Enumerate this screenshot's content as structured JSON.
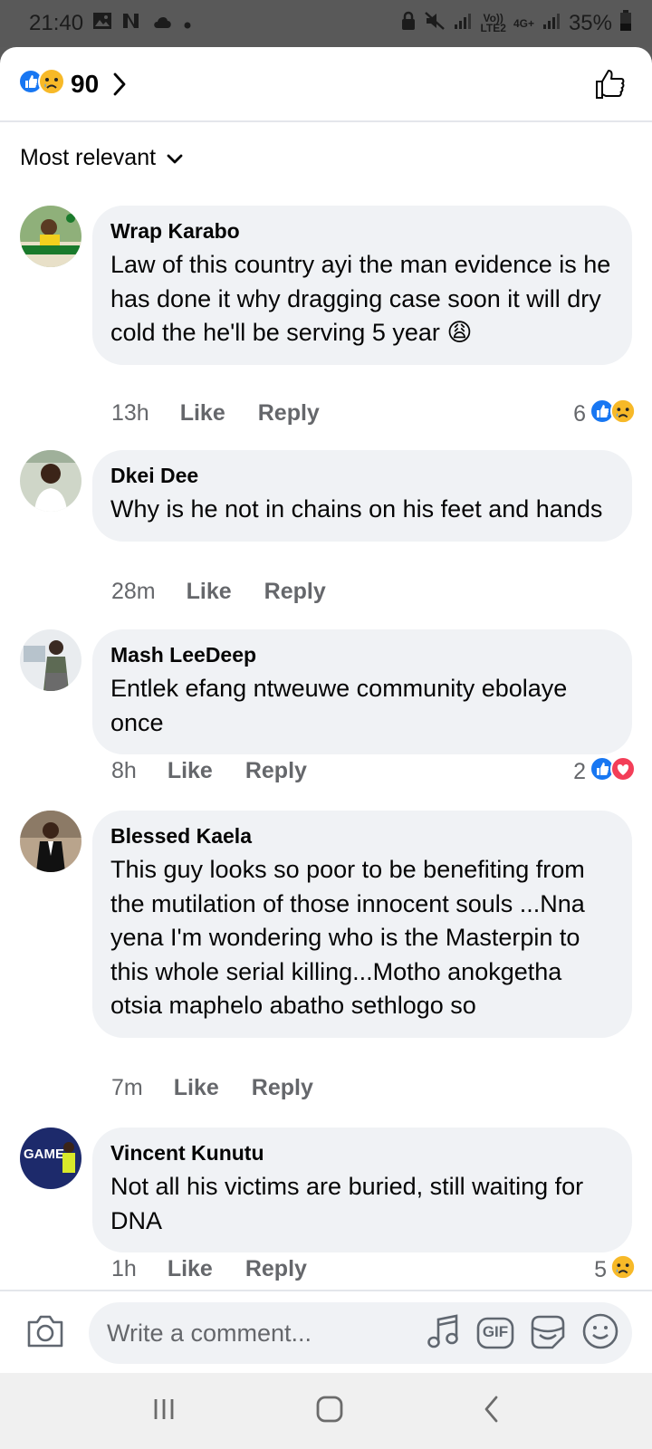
{
  "status_bar": {
    "time": "21:40",
    "signal_label_top": "Vo))",
    "signal_label_bottom": "LTE2",
    "network": "4G+",
    "battery": "35%"
  },
  "reactions_header": {
    "count": "90",
    "reaction_icons": [
      "like-icon",
      "sad-icon"
    ]
  },
  "sort": {
    "label": "Most relevant"
  },
  "comments": [
    {
      "author": "Wrap Karabo",
      "text": "Law of this country ayi the man evidence is he has done it why dragging case soon it will dry cold the he'll be serving 5 year 😩",
      "time": "13h",
      "like_label": "Like",
      "reply_label": "Reply",
      "reaction_count": "6",
      "reactions": [
        "like-icon",
        "sad-icon"
      ]
    },
    {
      "author": "Dkei Dee",
      "text": "Why is he not in chains on his feet and hands",
      "time": "28m",
      "like_label": "Like",
      "reply_label": "Reply"
    },
    {
      "author": "Mash LeeDeep",
      "text": "Entlek efang ntweuwe community ebolaye once",
      "time": "8h",
      "like_label": "Like",
      "reply_label": "Reply",
      "reaction_count": "2",
      "reactions": [
        "like-icon",
        "love-icon"
      ]
    },
    {
      "author": "Blessed Kaela",
      "text": "This guy looks so poor to be benefiting from the mutilation of those innocent souls ...Nna yena I'm wondering who is the Masterpin to this whole serial killing...Motho anokgetha otsia maphelo abatho sethlogo so",
      "time": "7m",
      "like_label": "Like",
      "reply_label": "Reply"
    },
    {
      "author": "Vincent Kunutu",
      "text": "Not all his victims are buried, still waiting for DNA",
      "time": "1h",
      "like_label": "Like",
      "reply_label": "Reply",
      "reaction_count": "5",
      "reactions": [
        "sad-icon"
      ]
    }
  ],
  "composer": {
    "placeholder": "Write a comment...",
    "gif_label": "GIF",
    "icons": [
      "camera-icon",
      "music-icon",
      "gif-icon",
      "sticker-icon",
      "emoji-icon"
    ]
  },
  "nav": {
    "icons": [
      "recent-apps-icon",
      "home-icon",
      "back-icon"
    ]
  },
  "colors": {
    "like_blue": "#1877f2",
    "love_red": "#f33e58",
    "sad_yellow": "#f7b928",
    "bubble_bg": "#f0f2f5",
    "meta_gray": "#65676b"
  }
}
